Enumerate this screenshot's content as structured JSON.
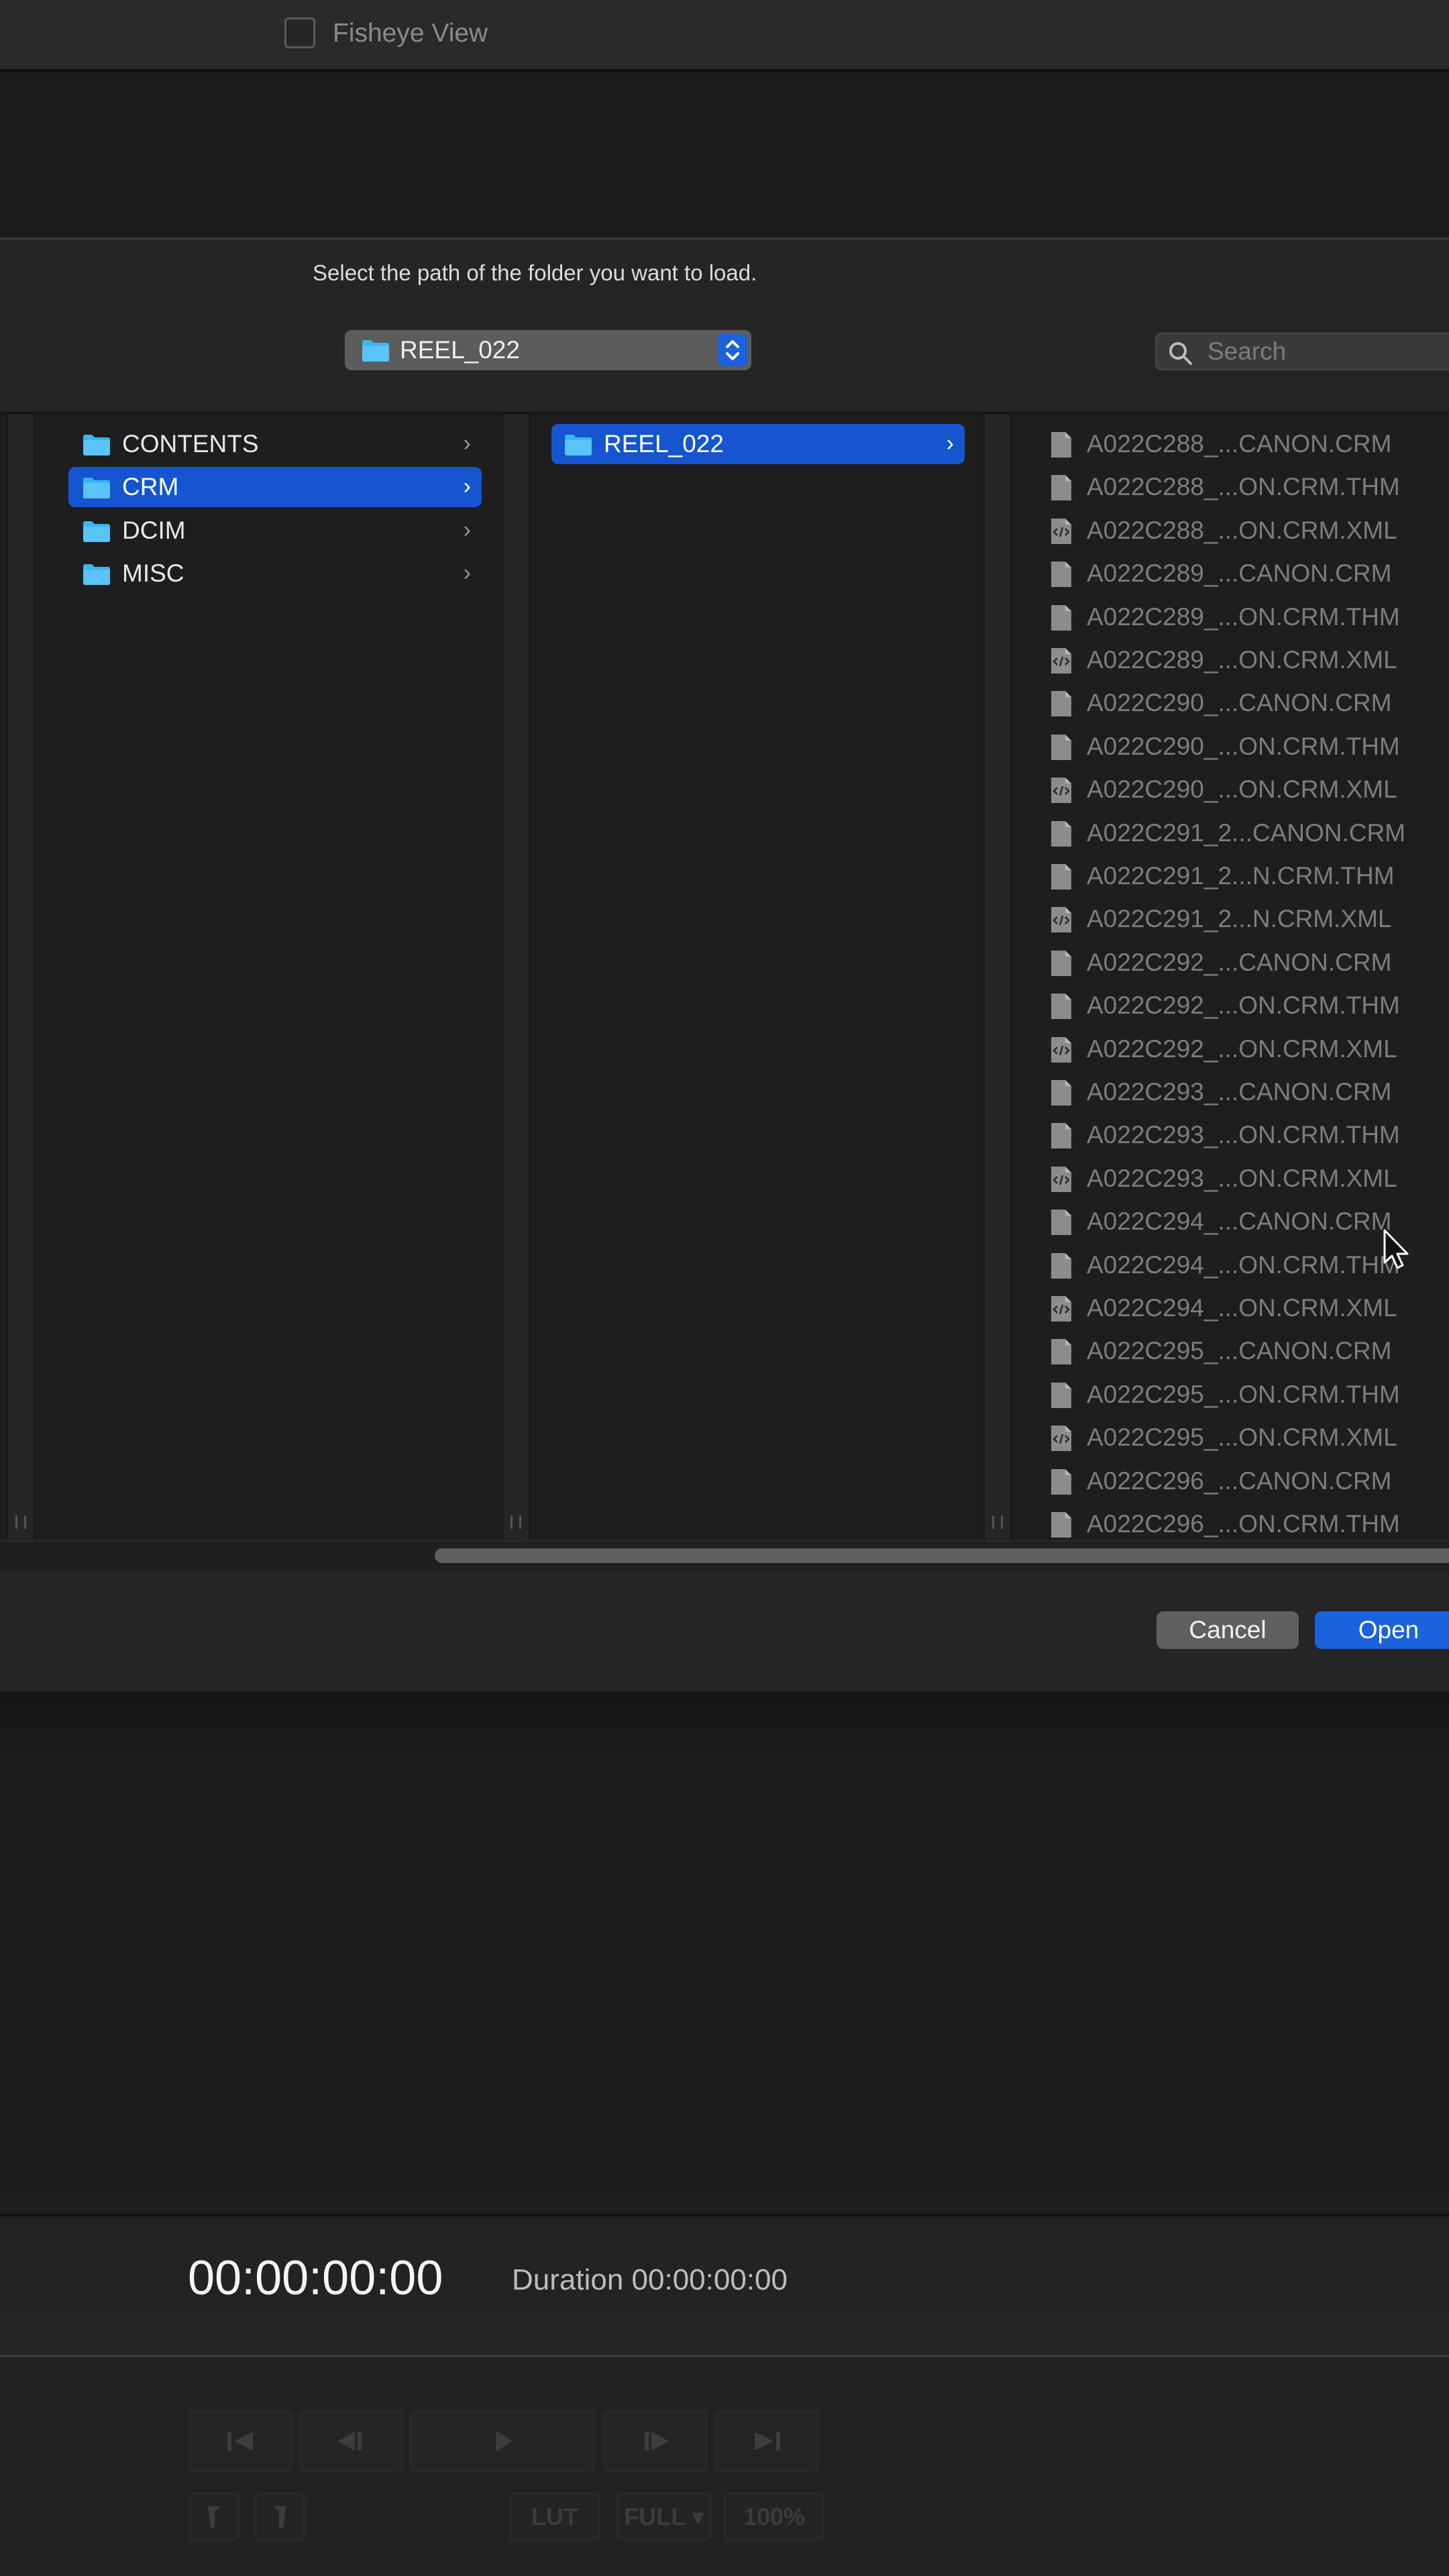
{
  "viewer_options": {
    "fisheye_label": "Fisheye View"
  },
  "dialog": {
    "prompt": "Select the path of the folder you want to load.",
    "path_popup_value": "REEL_022",
    "search_placeholder": "Search",
    "cancel_label": "Cancel",
    "open_label": "Open"
  },
  "browser": {
    "column1": [
      {
        "label": "CONTENTS",
        "selected": false
      },
      {
        "label": "CRM",
        "selected": true
      },
      {
        "label": "DCIM",
        "selected": false
      },
      {
        "label": "MISC",
        "selected": false
      }
    ],
    "column2": [
      {
        "label": "REEL_022",
        "selected": true
      }
    ],
    "files": [
      {
        "name": "A022C288_...CANON.CRM",
        "kind": "doc"
      },
      {
        "name": "A022C288_...ON.CRM.THM",
        "kind": "doc"
      },
      {
        "name": "A022C288_...ON.CRM.XML",
        "kind": "xml"
      },
      {
        "name": "A022C289_...CANON.CRM",
        "kind": "doc"
      },
      {
        "name": "A022C289_...ON.CRM.THM",
        "kind": "doc"
      },
      {
        "name": "A022C289_...ON.CRM.XML",
        "kind": "xml"
      },
      {
        "name": "A022C290_...CANON.CRM",
        "kind": "doc"
      },
      {
        "name": "A022C290_...ON.CRM.THM",
        "kind": "doc"
      },
      {
        "name": "A022C290_...ON.CRM.XML",
        "kind": "xml"
      },
      {
        "name": "A022C291_2...CANON.CRM",
        "kind": "doc"
      },
      {
        "name": "A022C291_2...N.CRM.THM",
        "kind": "doc"
      },
      {
        "name": "A022C291_2...N.CRM.XML",
        "kind": "xml"
      },
      {
        "name": "A022C292_...CANON.CRM",
        "kind": "doc"
      },
      {
        "name": "A022C292_...ON.CRM.THM",
        "kind": "doc"
      },
      {
        "name": "A022C292_...ON.CRM.XML",
        "kind": "xml"
      },
      {
        "name": "A022C293_...CANON.CRM",
        "kind": "doc"
      },
      {
        "name": "A022C293_...ON.CRM.THM",
        "kind": "doc"
      },
      {
        "name": "A022C293_...ON.CRM.XML",
        "kind": "xml"
      },
      {
        "name": "A022C294_...CANON.CRM",
        "kind": "doc"
      },
      {
        "name": "A022C294_...ON.CRM.THM",
        "kind": "doc"
      },
      {
        "name": "A022C294_...ON.CRM.XML",
        "kind": "xml"
      },
      {
        "name": "A022C295_...CANON.CRM",
        "kind": "doc"
      },
      {
        "name": "A022C295_...ON.CRM.THM",
        "kind": "doc"
      },
      {
        "name": "A022C295_...ON.CRM.XML",
        "kind": "xml"
      },
      {
        "name": "A022C296_...CANON.CRM",
        "kind": "doc"
      },
      {
        "name": "A022C296_...ON.CRM.THM",
        "kind": "doc"
      }
    ]
  },
  "viewer": {
    "current_timecode": "00:00:00:00",
    "duration": "Duration 00:00:00:00",
    "lut_label": "LUT",
    "full_label": "FULL ▾",
    "zoom_label": "100%"
  },
  "colors": {
    "accent": "#1b62dd",
    "selection": "#1555d0",
    "folder": "#38b6f5"
  }
}
